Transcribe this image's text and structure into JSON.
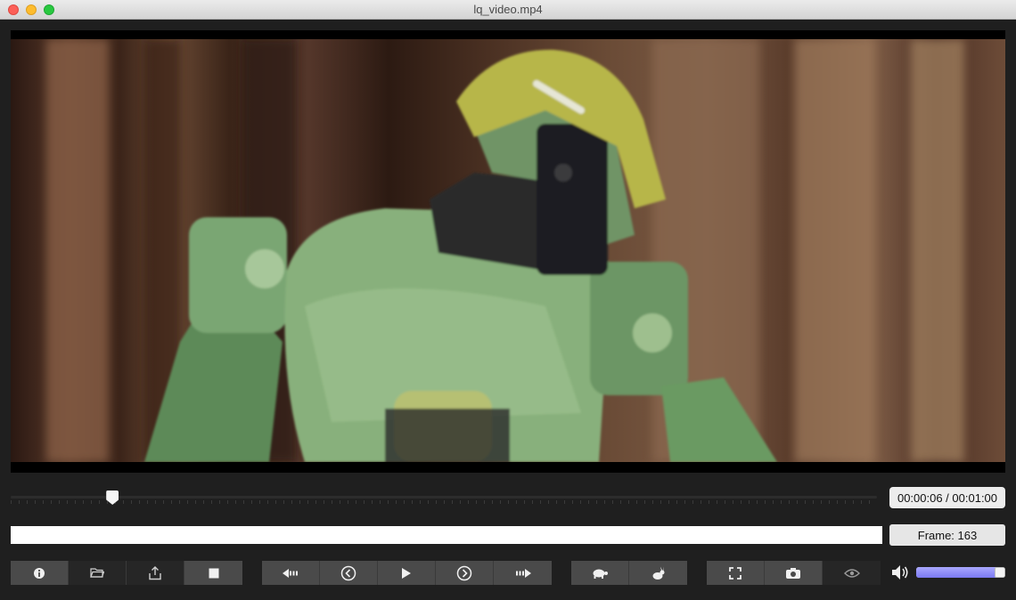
{
  "window": {
    "title": "lq_video.mp4"
  },
  "player": {
    "time_display": "00:00:06 / 00:01:00",
    "frame_display": "Frame: 163",
    "seek_fraction": 0.1,
    "volume_fraction": 0.9
  },
  "controls": {
    "group1": [
      {
        "name": "info-button",
        "icon": "info-icon"
      },
      {
        "name": "open-folder-button",
        "icon": "folder-icon"
      },
      {
        "name": "export-button",
        "icon": "share-icon"
      },
      {
        "name": "stop-button",
        "icon": "stop-icon"
      }
    ],
    "group2": [
      {
        "name": "rewind-button",
        "icon": "rewind-icon"
      },
      {
        "name": "prev-frame-button",
        "icon": "chevron-left-circle-icon"
      },
      {
        "name": "play-button",
        "icon": "play-icon"
      },
      {
        "name": "next-frame-button",
        "icon": "chevron-right-circle-icon"
      },
      {
        "name": "fast-forward-button",
        "icon": "fast-forward-icon"
      }
    ],
    "group3": [
      {
        "name": "slow-speed-button",
        "icon": "turtle-icon"
      },
      {
        "name": "fast-speed-button",
        "icon": "rabbit-icon"
      }
    ],
    "group4": [
      {
        "name": "fullscreen-button",
        "icon": "fullscreen-icon"
      },
      {
        "name": "snapshot-button",
        "icon": "camera-icon"
      },
      {
        "name": "visibility-button",
        "icon": "eye-icon"
      }
    ],
    "volume_icon": "speaker-icon"
  }
}
